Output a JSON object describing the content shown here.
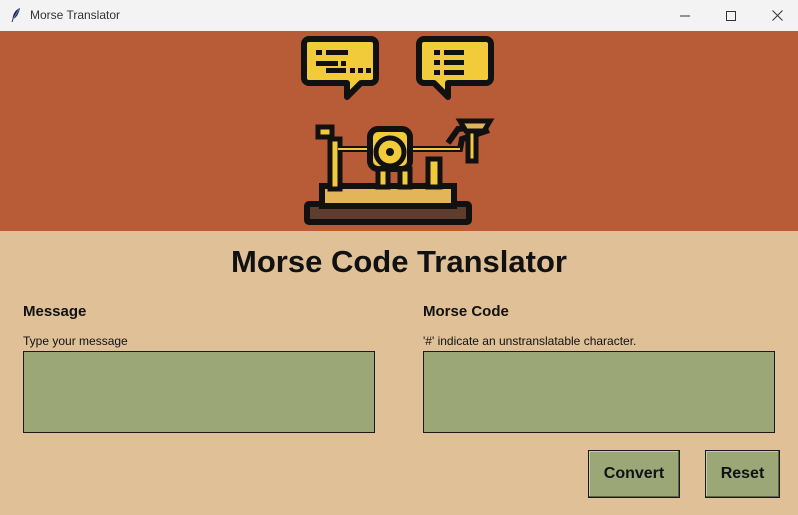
{
  "window": {
    "title": "Morse Translator",
    "icon": "feather-icon",
    "controls": [
      "minimize-icon",
      "maximize-icon",
      "close-icon"
    ]
  },
  "banner": {
    "illustration": "telegraph-key-with-speech-bubbles",
    "background_color": "#b85c38"
  },
  "main": {
    "title": "Morse Code Translator",
    "background_color": "#e0c097",
    "message": {
      "heading": "Message",
      "hint": "Type your message",
      "value": ""
    },
    "morse": {
      "heading": "Morse Code",
      "hint": "'#' indicate an unstranslatable character.",
      "value": ""
    },
    "buttons": {
      "convert_label": "Convert",
      "reset_label": "Reset"
    },
    "field_color": "#9ca777"
  }
}
